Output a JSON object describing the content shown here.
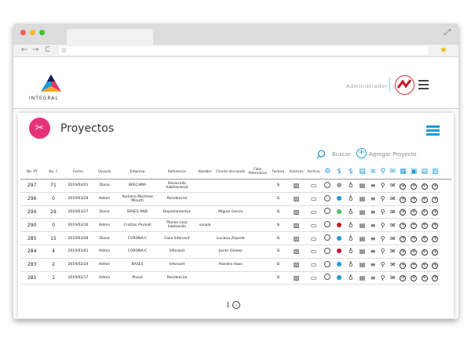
{
  "app": {
    "logo_text": "INTEGRAL",
    "user_label": "Administrador",
    "page_title": "Proyectos",
    "search_label": "Buscar",
    "add_label": "Agregar Proyecto",
    "page_number": "1"
  },
  "colors": {
    "accent": "#1d9ad6",
    "brand_pink": "#e8327a"
  },
  "table": {
    "headers": [
      "No. PY",
      "No. C",
      "Fecha",
      "Usuario",
      "Empresa",
      "Referencia",
      "Nombre",
      "Cliente Vinculado",
      "Folio Alternativo",
      "Factura",
      "Avances",
      "Archivo"
    ],
    "rows": [
      {
        "py": "297",
        "c": "71",
        "fecha": "2019/04/01",
        "usuario": "Diana",
        "empresa": "BRECAMA",
        "referencia": "Desarrollo habitacional",
        "nombre": "",
        "cliente": "",
        "folio": "",
        "factura": "Si",
        "ball": "#9aa0a6"
      },
      {
        "py": "296",
        "c": "0",
        "fecha": "2019/03/28",
        "usuario": "Admin",
        "empresa": "Rumano Martinez Minutti",
        "referencia": "Residencial",
        "nombre": "",
        "cliente": "",
        "folio": "",
        "factura": "Si",
        "ball": "#1d9ad6"
      },
      {
        "py": "294",
        "c": "29",
        "fecha": "2019/03/27",
        "usuario": "Diana",
        "empresa": "BASES AND",
        "referencia": "Departamentos",
        "nombre": "",
        "cliente": "Miguel Garcia",
        "folio": "",
        "factura": "Si",
        "ball": "#4cc35e"
      },
      {
        "py": "290",
        "c": "0",
        "fecha": "2019/03/16",
        "usuario": "Admin",
        "empresa": "Cristian Plumall",
        "referencia": "Planos casa habitación",
        "nombre": "sonala",
        "cliente": "",
        "folio": "",
        "factura": "Si",
        "ball": "#c4182b"
      },
      {
        "py": "285",
        "c": "15",
        "fecha": "2019/03/08",
        "usuario": "Diana",
        "empresa": "CORONA-C",
        "referencia": "Casa Infonavit",
        "nombre": "",
        "cliente": "Luciana Zepeda",
        "folio": "",
        "factura": "Si",
        "ball": "#1d9ad6"
      },
      {
        "py": "284",
        "c": "4",
        "fecha": "2019/03/01",
        "usuario": "Admin",
        "empresa": "CORONA-C",
        "referencia": "Infonavit",
        "nombre": "",
        "cliente": "Javier Gómez",
        "folio": "",
        "factura": "Si",
        "ball": "#c4182b"
      },
      {
        "py": "283",
        "c": "2",
        "fecha": "2019/02/24",
        "usuario": "Admin",
        "empresa": "BASES",
        "referencia": "Infonavit",
        "nombre": "",
        "cliente": "Alondra Haas",
        "folio": "",
        "factura": "Si",
        "ball": "#1d9ad6"
      },
      {
        "py": "281",
        "c": "1",
        "fecha": "2019/02/17",
        "usuario": "Admin",
        "empresa": "Plusol",
        "referencia": "Residencial",
        "nombre": "",
        "cliente": "",
        "folio": "",
        "factura": "Si",
        "ball": "#1d9ad6"
      }
    ]
  },
  "icons": [
    "image-icon",
    "file-icon",
    "settings-icon",
    "dollar-icon",
    "money-bag-icon",
    "chat-icon",
    "list-icon",
    "search-icon",
    "mail-icon",
    "document-icon",
    "clipboard-icon",
    "pdf-icon",
    "add-circle-icon"
  ]
}
